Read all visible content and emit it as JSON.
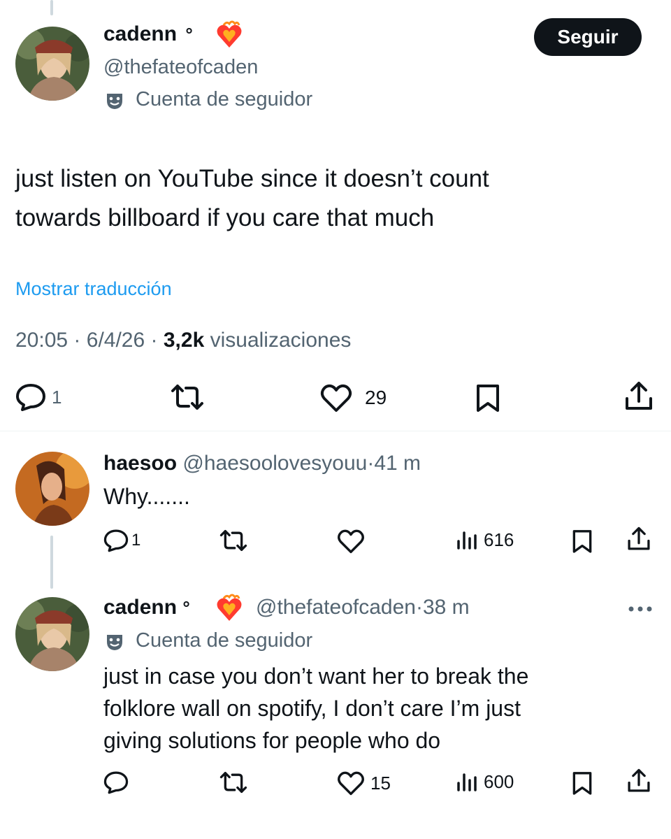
{
  "colors": {
    "text": "#0f1419",
    "muted": "#536471",
    "link": "#1d9bf0",
    "line": "#cfd9de"
  },
  "main_tweet": {
    "display_name": "cadenn",
    "badge_circle": "°",
    "handle": "@thefateofcaden",
    "account_label": "Cuenta de seguidor",
    "account_icon": "theater-masks-icon",
    "follow_label": "Seguir",
    "text_line1": "just listen on YouTube since it doesn’t count",
    "text_line2": "towards billboard if you care that much",
    "translate_label": "Mostrar traducción",
    "time": "20:05",
    "sep": "·",
    "date": "6/4/26",
    "views_count": "3,2k",
    "views_label": "visualizaciones",
    "replies": "1",
    "likes": "29"
  },
  "reply1": {
    "display_name": "haesoo",
    "handle": "@haesoolovesyouu",
    "sep": "·",
    "age": "41 m",
    "text": "Why.......",
    "replies": "1",
    "views": "616"
  },
  "reply2": {
    "display_name": "cadenn",
    "badge_circle": "°",
    "handle": "@thefateofcaden",
    "sep": "·",
    "age": "38 m",
    "account_label": "Cuenta de seguidor",
    "text_line1": "just in case you don’t want her to break the",
    "text_line2": "folklore wall on spotify, I don’t care I’m just",
    "text_line3": "giving solutions for people who do",
    "likes": "15",
    "views": "600"
  }
}
